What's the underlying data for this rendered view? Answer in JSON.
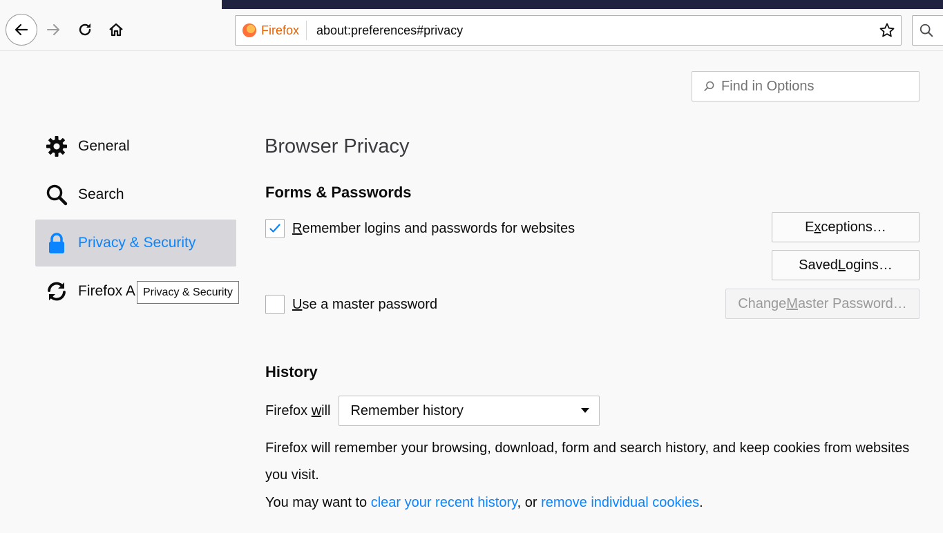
{
  "browser": {
    "identity_label": "Firefox",
    "url": "about:preferences#privacy",
    "icons": {
      "back": "back-arrow-icon",
      "forward": "forward-arrow-icon",
      "reload": "reload-icon",
      "home": "home-icon",
      "bookmark": "star-icon",
      "search": "search-icon"
    }
  },
  "find": {
    "placeholder": "Find in Options"
  },
  "sidebar": {
    "items": [
      {
        "label": "General",
        "icon": "gear-icon"
      },
      {
        "label": "Search",
        "icon": "search-icon"
      },
      {
        "label": "Privacy & Security",
        "icon": "lock-icon",
        "selected": true
      },
      {
        "label": "Firefox A",
        "icon": "sync-icon"
      }
    ],
    "tooltip": "Privacy & Security"
  },
  "main": {
    "title": "Browser Privacy",
    "forms": {
      "heading": "Forms & Passwords",
      "remember_pre": "",
      "remember_accel": "R",
      "remember_post": "emember logins and passwords for websites",
      "remember_checked": true,
      "master_accel": "U",
      "master_post": "se a master password",
      "master_checked": false,
      "exceptions_pre": "E",
      "exceptions_accel": "x",
      "exceptions_post": "ceptions…",
      "saved_pre": "Saved ",
      "saved_accel": "L",
      "saved_post": "ogins…",
      "change_pre": "Change ",
      "change_accel": "M",
      "change_post": "aster Password…"
    },
    "history": {
      "heading": "History",
      "will_pre": "Firefox ",
      "will_accel": "w",
      "will_post": "ill",
      "select_value": "Remember history",
      "description": "Firefox will remember your browsing, download, form and search history, and keep cookies from websites you visit.",
      "suggest_pre": "You may want to ",
      "link_clear": "clear your recent history",
      "suggest_mid": ", or ",
      "link_cookies": "remove individual cookies",
      "suggest_post": "."
    }
  },
  "colors": {
    "accent": "#0a84ff",
    "selected_bg": "#d7d7db",
    "tab_strip": "#202340"
  }
}
